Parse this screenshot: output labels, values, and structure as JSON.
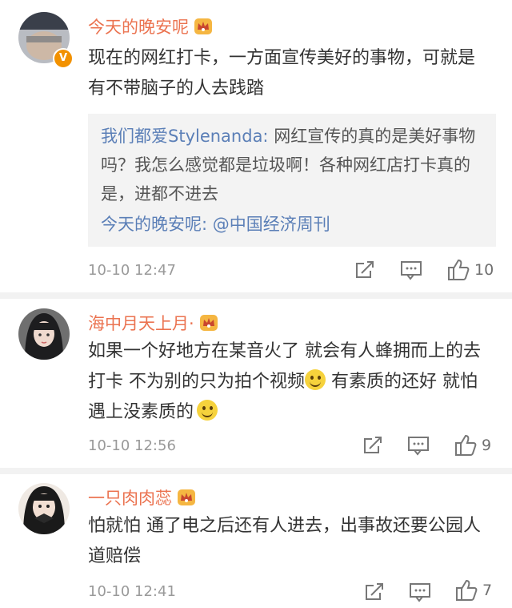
{
  "comments": [
    {
      "name": "今天的晚安呢",
      "text": "现在的网红打卡，一方面宣传美好的事物，可就是有不带脑子的人去践踏",
      "quote": {
        "author": "我们都爱Stylenanda:",
        "text": " 网红宣传的真的是美好事物吗？我怎么感觉都是垃圾啊！各种网红店打卡真的是，进都不进去",
        "reply": "今天的晚安呢: @中国经济周刊"
      },
      "time": "10-10 12:47",
      "likes": "10"
    },
    {
      "name": "海中月天上月·",
      "text_parts": [
        "如果一个好地方在某音火了 就会有人蜂拥而上的去打卡 不为别的只为拍个视频",
        " 有素质的还好 就怕遇上没素质的"
      ],
      "time": "10-10 12:56",
      "likes": "9"
    },
    {
      "name": "一只肉肉蕊",
      "text": "怕就怕 通了电之后还有人进去，出事故还要公园人道赔偿",
      "time": "10-10 12:41",
      "likes": "7"
    }
  ],
  "icons": {
    "share": "share-icon",
    "comment": "comment-icon",
    "like": "thumbs-up-icon",
    "badge": "crown-badge-icon",
    "verified": "verified-icon"
  },
  "colors": {
    "name": "#eb7350",
    "link": "#5b7fb7",
    "meta": "#9a9a9a"
  }
}
